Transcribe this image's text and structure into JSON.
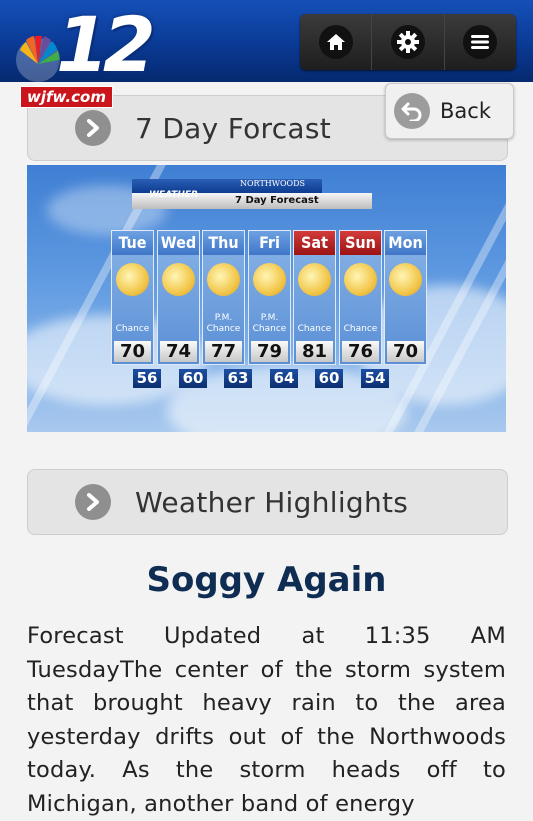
{
  "header": {
    "logo_number": "12",
    "logo_site": "wjfw.com",
    "toolbar": [
      {
        "icon": "home-icon"
      },
      {
        "icon": "gear-icon"
      },
      {
        "icon": "menu-icon"
      }
    ],
    "back_label": "Back"
  },
  "forecast_section": {
    "title": "7 Day Forcast",
    "graphic": {
      "sponsor": "NORTHWOODS",
      "brand": "WEATHER",
      "title": "7 Day Forecast",
      "days": [
        {
          "name": "Tue",
          "note": "Chance",
          "high": "70",
          "low": "56",
          "weekend": false
        },
        {
          "name": "Wed",
          "note": "",
          "high": "74",
          "low": "60",
          "weekend": false
        },
        {
          "name": "Thu",
          "note": "P.M. Chance",
          "high": "77",
          "low": "63",
          "weekend": false
        },
        {
          "name": "Fri",
          "note": "P.M. Chance",
          "high": "79",
          "low": "64",
          "weekend": false
        },
        {
          "name": "Sat",
          "note": "Chance",
          "high": "81",
          "low": "60",
          "weekend": true
        },
        {
          "name": "Sun",
          "note": "Chance",
          "high": "76",
          "low": "54",
          "weekend": true
        },
        {
          "name": "Mon",
          "note": "",
          "high": "70",
          "low": "",
          "weekend": false
        }
      ]
    }
  },
  "highlights_section": {
    "title": "Weather Highlights"
  },
  "article": {
    "headline": "Soggy Again",
    "body": "Forecast Updated at 11:35 AM TuesdayThe center of the storm system that brought heavy rain to the area yesterday drifts out of the Northwoods today. As the storm heads off to Michigan, another band of energy"
  }
}
